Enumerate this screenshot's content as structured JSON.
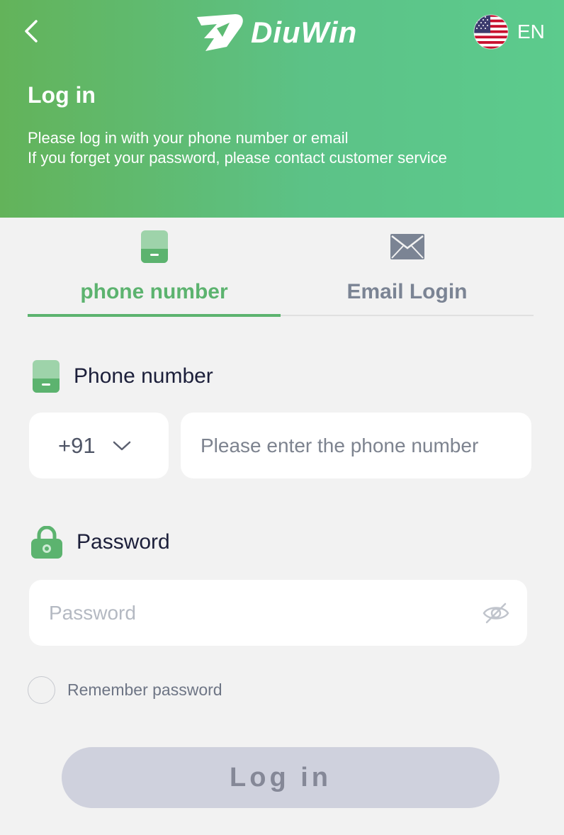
{
  "header": {
    "brand": "DiuWin",
    "language": "EN",
    "title": "Log in",
    "subtitle_line1": "Please log in with your phone number or email",
    "subtitle_line2": "If you forget your password, please contact customer service"
  },
  "tabs": [
    {
      "label": "phone number",
      "active": true,
      "icon": "phone-icon"
    },
    {
      "label": "Email Login",
      "active": false,
      "icon": "envelope-icon"
    }
  ],
  "form": {
    "phone_label": "Phone number",
    "country_code": "+91",
    "phone_placeholder": "Please enter the phone number",
    "password_label": "Password",
    "password_placeholder": "Password",
    "remember_label": "Remember password",
    "submit_label": "Log in"
  },
  "colors": {
    "accent": "#5cb36f",
    "header_gradient_start": "#63b35a",
    "header_gradient_end": "#5ccb8d",
    "button_disabled": "#cfd1dd"
  }
}
